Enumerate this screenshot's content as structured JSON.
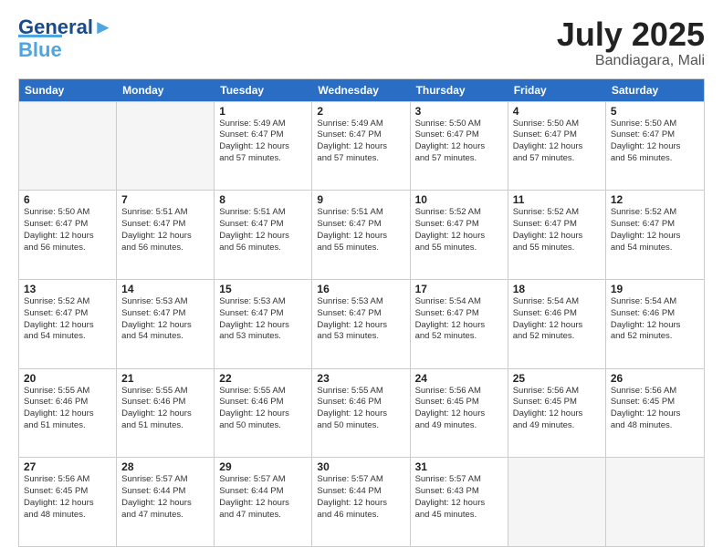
{
  "logo": {
    "line1": "General",
    "line2": "Blue"
  },
  "title": {
    "month_year": "July 2025",
    "location": "Bandiagara, Mali"
  },
  "days_of_week": [
    "Sunday",
    "Monday",
    "Tuesday",
    "Wednesday",
    "Thursday",
    "Friday",
    "Saturday"
  ],
  "weeks": [
    [
      {
        "day": "",
        "lines": [],
        "empty": true
      },
      {
        "day": "",
        "lines": [],
        "empty": true
      },
      {
        "day": "1",
        "lines": [
          "Sunrise: 5:49 AM",
          "Sunset: 6:47 PM",
          "Daylight: 12 hours",
          "and 57 minutes."
        ]
      },
      {
        "day": "2",
        "lines": [
          "Sunrise: 5:49 AM",
          "Sunset: 6:47 PM",
          "Daylight: 12 hours",
          "and 57 minutes."
        ]
      },
      {
        "day": "3",
        "lines": [
          "Sunrise: 5:50 AM",
          "Sunset: 6:47 PM",
          "Daylight: 12 hours",
          "and 57 minutes."
        ]
      },
      {
        "day": "4",
        "lines": [
          "Sunrise: 5:50 AM",
          "Sunset: 6:47 PM",
          "Daylight: 12 hours",
          "and 57 minutes."
        ]
      },
      {
        "day": "5",
        "lines": [
          "Sunrise: 5:50 AM",
          "Sunset: 6:47 PM",
          "Daylight: 12 hours",
          "and 56 minutes."
        ]
      }
    ],
    [
      {
        "day": "6",
        "lines": [
          "Sunrise: 5:50 AM",
          "Sunset: 6:47 PM",
          "Daylight: 12 hours",
          "and 56 minutes."
        ]
      },
      {
        "day": "7",
        "lines": [
          "Sunrise: 5:51 AM",
          "Sunset: 6:47 PM",
          "Daylight: 12 hours",
          "and 56 minutes."
        ]
      },
      {
        "day": "8",
        "lines": [
          "Sunrise: 5:51 AM",
          "Sunset: 6:47 PM",
          "Daylight: 12 hours",
          "and 56 minutes."
        ]
      },
      {
        "day": "9",
        "lines": [
          "Sunrise: 5:51 AM",
          "Sunset: 6:47 PM",
          "Daylight: 12 hours",
          "and 55 minutes."
        ]
      },
      {
        "day": "10",
        "lines": [
          "Sunrise: 5:52 AM",
          "Sunset: 6:47 PM",
          "Daylight: 12 hours",
          "and 55 minutes."
        ]
      },
      {
        "day": "11",
        "lines": [
          "Sunrise: 5:52 AM",
          "Sunset: 6:47 PM",
          "Daylight: 12 hours",
          "and 55 minutes."
        ]
      },
      {
        "day": "12",
        "lines": [
          "Sunrise: 5:52 AM",
          "Sunset: 6:47 PM",
          "Daylight: 12 hours",
          "and 54 minutes."
        ]
      }
    ],
    [
      {
        "day": "13",
        "lines": [
          "Sunrise: 5:52 AM",
          "Sunset: 6:47 PM",
          "Daylight: 12 hours",
          "and 54 minutes."
        ]
      },
      {
        "day": "14",
        "lines": [
          "Sunrise: 5:53 AM",
          "Sunset: 6:47 PM",
          "Daylight: 12 hours",
          "and 54 minutes."
        ]
      },
      {
        "day": "15",
        "lines": [
          "Sunrise: 5:53 AM",
          "Sunset: 6:47 PM",
          "Daylight: 12 hours",
          "and 53 minutes."
        ]
      },
      {
        "day": "16",
        "lines": [
          "Sunrise: 5:53 AM",
          "Sunset: 6:47 PM",
          "Daylight: 12 hours",
          "and 53 minutes."
        ]
      },
      {
        "day": "17",
        "lines": [
          "Sunrise: 5:54 AM",
          "Sunset: 6:47 PM",
          "Daylight: 12 hours",
          "and 52 minutes."
        ]
      },
      {
        "day": "18",
        "lines": [
          "Sunrise: 5:54 AM",
          "Sunset: 6:46 PM",
          "Daylight: 12 hours",
          "and 52 minutes."
        ]
      },
      {
        "day": "19",
        "lines": [
          "Sunrise: 5:54 AM",
          "Sunset: 6:46 PM",
          "Daylight: 12 hours",
          "and 52 minutes."
        ]
      }
    ],
    [
      {
        "day": "20",
        "lines": [
          "Sunrise: 5:55 AM",
          "Sunset: 6:46 PM",
          "Daylight: 12 hours",
          "and 51 minutes."
        ]
      },
      {
        "day": "21",
        "lines": [
          "Sunrise: 5:55 AM",
          "Sunset: 6:46 PM",
          "Daylight: 12 hours",
          "and 51 minutes."
        ]
      },
      {
        "day": "22",
        "lines": [
          "Sunrise: 5:55 AM",
          "Sunset: 6:46 PM",
          "Daylight: 12 hours",
          "and 50 minutes."
        ]
      },
      {
        "day": "23",
        "lines": [
          "Sunrise: 5:55 AM",
          "Sunset: 6:46 PM",
          "Daylight: 12 hours",
          "and 50 minutes."
        ]
      },
      {
        "day": "24",
        "lines": [
          "Sunrise: 5:56 AM",
          "Sunset: 6:45 PM",
          "Daylight: 12 hours",
          "and 49 minutes."
        ]
      },
      {
        "day": "25",
        "lines": [
          "Sunrise: 5:56 AM",
          "Sunset: 6:45 PM",
          "Daylight: 12 hours",
          "and 49 minutes."
        ]
      },
      {
        "day": "26",
        "lines": [
          "Sunrise: 5:56 AM",
          "Sunset: 6:45 PM",
          "Daylight: 12 hours",
          "and 48 minutes."
        ]
      }
    ],
    [
      {
        "day": "27",
        "lines": [
          "Sunrise: 5:56 AM",
          "Sunset: 6:45 PM",
          "Daylight: 12 hours",
          "and 48 minutes."
        ]
      },
      {
        "day": "28",
        "lines": [
          "Sunrise: 5:57 AM",
          "Sunset: 6:44 PM",
          "Daylight: 12 hours",
          "and 47 minutes."
        ]
      },
      {
        "day": "29",
        "lines": [
          "Sunrise: 5:57 AM",
          "Sunset: 6:44 PM",
          "Daylight: 12 hours",
          "and 47 minutes."
        ]
      },
      {
        "day": "30",
        "lines": [
          "Sunrise: 5:57 AM",
          "Sunset: 6:44 PM",
          "Daylight: 12 hours",
          "and 46 minutes."
        ]
      },
      {
        "day": "31",
        "lines": [
          "Sunrise: 5:57 AM",
          "Sunset: 6:43 PM",
          "Daylight: 12 hours",
          "and 45 minutes."
        ]
      },
      {
        "day": "",
        "lines": [],
        "empty": true
      },
      {
        "day": "",
        "lines": [],
        "empty": true
      }
    ]
  ]
}
